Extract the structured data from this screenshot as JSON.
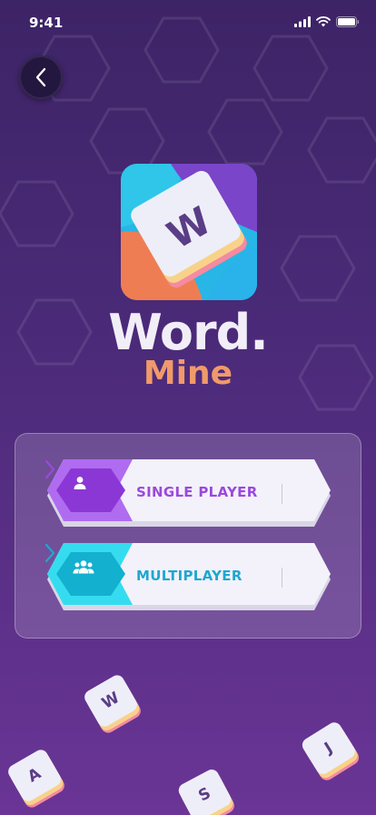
{
  "status_bar": {
    "time": "9:41"
  },
  "logo": {
    "tile_letter": "W",
    "title_line1": "Word.",
    "title_line2": "Mine"
  },
  "modes": [
    {
      "label": "SINGLE PLAYER",
      "icon": "single-user-icon",
      "accent": "#a24ce8",
      "text_color": "#9b49dd"
    },
    {
      "label": "MULTIPLAYER",
      "icon": "multi-user-icon",
      "accent": "#22c6df",
      "text_color": "#1fa7d1"
    }
  ],
  "floating_tiles": [
    {
      "letter": "W"
    },
    {
      "letter": "J"
    },
    {
      "letter": "A"
    },
    {
      "letter": "S"
    }
  ],
  "colors": {
    "logo_orange": "#f09a6a",
    "title_white": "#f2eef8",
    "bg_top": "#3d2466",
    "bg_bottom": "#6a3596"
  }
}
